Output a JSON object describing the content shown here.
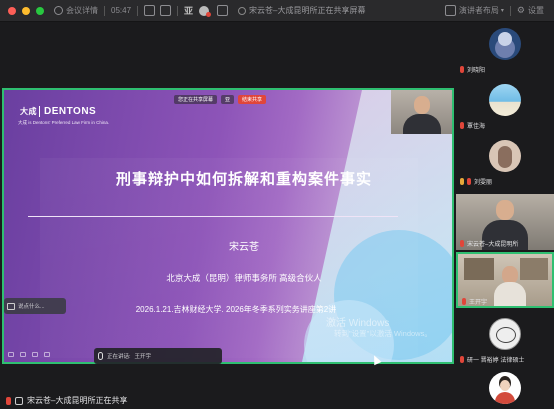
{
  "topbar": {
    "meeting_details": "会议详情",
    "timer": "05:47",
    "sharing_status": "宋云苍–大成昆明所正在共享屏幕",
    "layout_label": "演讲者布局",
    "settings_label": "设置"
  },
  "slide": {
    "brand": "大成DENTONS",
    "brand_box": "大成",
    "brand_text": "DENTONS",
    "brand_tag": "大成 is Dentons' Preferred Law Firm in China.",
    "title": "刑事辩护中如何拆解和重构案件事实",
    "speaker": "宋云苍",
    "firm": "北京大成（昆明）律师事务所    高级合伙人",
    "event": "2026.1.21.吉林财经大学. 2026年冬季系列实务讲座第2讲",
    "toolbar_share": "您正在共享屏幕",
    "toolbar_stop": "结束共享",
    "watermark": "激活 Windows",
    "watermark_sub": "转到\"设置\"以激活 Windows。"
  },
  "overlays": {
    "chat_placeholder": "说点什么...",
    "speaking_label": "正在讲话:",
    "speaking_name": "王开宇"
  },
  "participants": [
    {
      "name": "刘晓阳",
      "muted": true
    },
    {
      "name": "覃佳海",
      "muted": true
    },
    {
      "name": "刘雯丽",
      "muted": true
    },
    {
      "name": "宋云苍–大成昆明所",
      "muted": true
    },
    {
      "name": "王开宇",
      "muted": true
    },
    {
      "name": "研一 晋裕婷  法律硕士",
      "muted": true
    },
    {
      "name": "",
      "muted": true
    }
  ],
  "bottombar": {
    "sharing_text": "宋云苍–大成昆明所正在共享"
  },
  "colors": {
    "share_border": "#2fbf71",
    "slide_purple": "#6a3fa0",
    "mute_red": "#e0463a"
  }
}
